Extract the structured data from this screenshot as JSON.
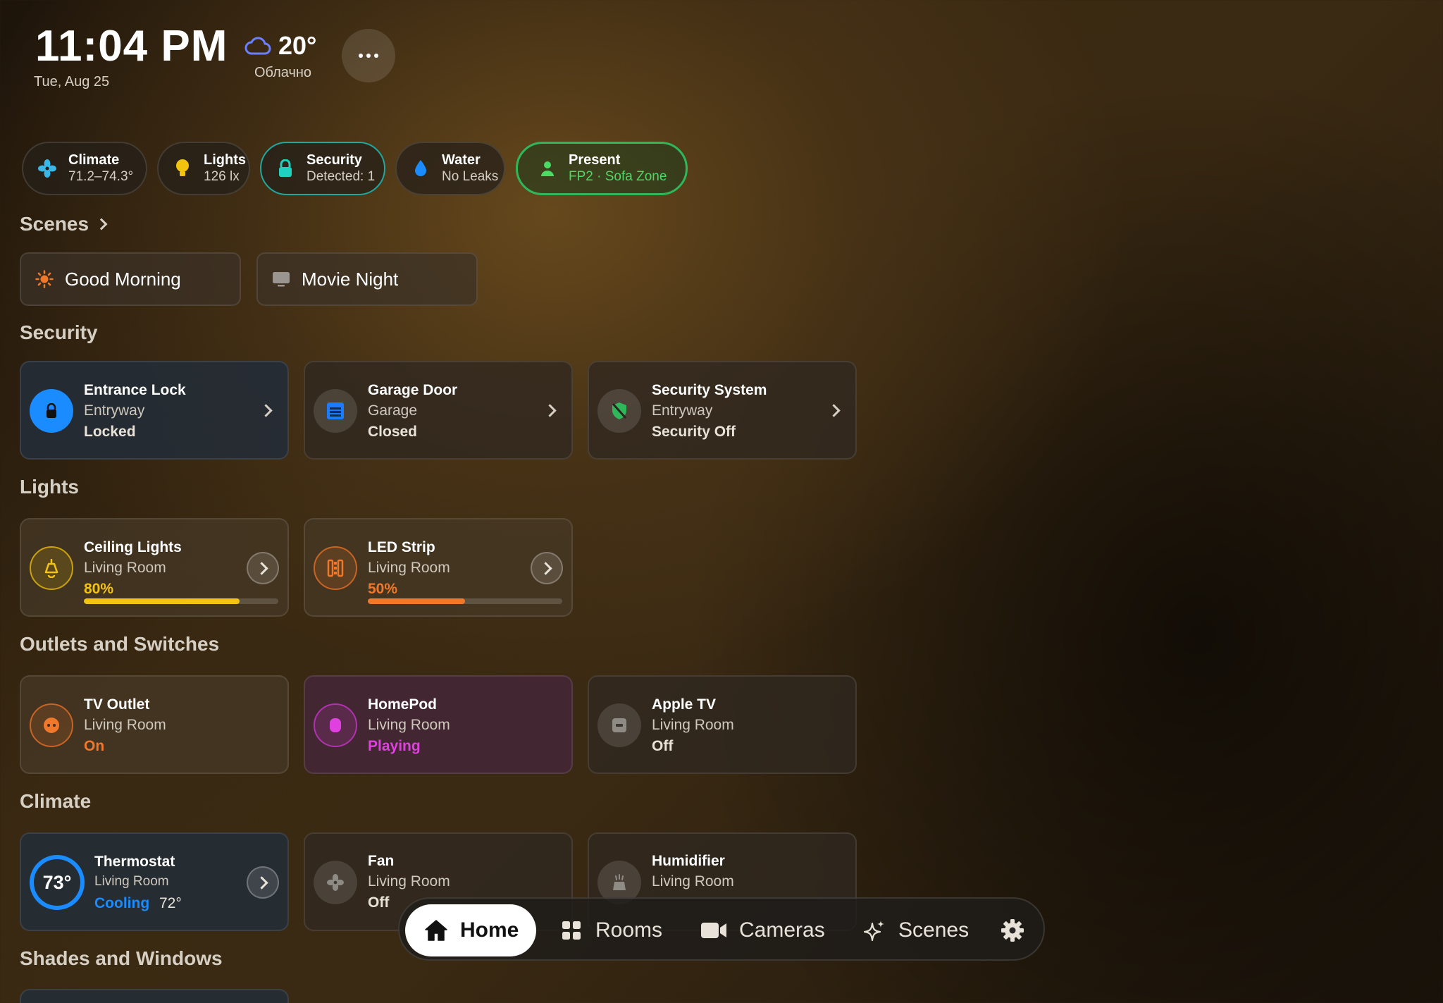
{
  "header": {
    "time": "11:04 PM",
    "date": "Tue, Aug 25",
    "temperature": "20°",
    "condition": "Облачно"
  },
  "status_chips": [
    {
      "title": "Climate",
      "subtitle": "71.2–74.3°",
      "icon": "fan-icon"
    },
    {
      "title": "Lights",
      "subtitle": "126 lx",
      "icon": "bulb-icon"
    },
    {
      "title": "Security",
      "subtitle": "Detected: 1",
      "icon": "lock-icon"
    },
    {
      "title": "Water",
      "subtitle": "No Leaks",
      "icon": "drop-icon"
    },
    {
      "title": "Present",
      "subtitle": "FP2 · Sofa Zone",
      "icon": "person-icon"
    }
  ],
  "sections": {
    "scenes": "Scenes",
    "security": "Security",
    "lights": "Lights",
    "outlets": "Outlets and Switches",
    "climate": "Climate",
    "shades": "Shades and Windows"
  },
  "scenes": [
    {
      "label": "Good Morning",
      "icon": "sun-icon"
    },
    {
      "label": "Movie Night",
      "icon": "tv-icon"
    }
  ],
  "security": [
    {
      "name": "Entrance Lock",
      "room": "Entryway",
      "state": "Locked"
    },
    {
      "name": "Garage Door",
      "room": "Garage",
      "state": "Closed"
    },
    {
      "name": "Security System",
      "room": "Entryway",
      "state": "Security Off"
    }
  ],
  "lights": [
    {
      "name": "Ceiling Lights",
      "room": "Living Room",
      "state": "80%",
      "level": 0.8
    },
    {
      "name": "LED Strip",
      "room": "Living Room",
      "state": "50%",
      "level": 0.5
    }
  ],
  "outlets": [
    {
      "name": "TV Outlet",
      "room": "Living Room",
      "state": "On"
    },
    {
      "name": "HomePod",
      "room": "Living Room",
      "state": "Playing"
    },
    {
      "name": "Apple TV",
      "room": "Living Room",
      "state": "Off"
    }
  ],
  "climate": [
    {
      "name": "Thermostat",
      "room": "Living Room",
      "state": "Cooling",
      "target": "72°",
      "current": "73°"
    },
    {
      "name": "Fan",
      "room": "Living Room",
      "state": "Off"
    },
    {
      "name": "Humidifier",
      "room": "Living Room"
    }
  ],
  "nav": [
    {
      "label": "Home"
    },
    {
      "label": "Rooms"
    },
    {
      "label": "Cameras"
    },
    {
      "label": "Scenes"
    }
  ],
  "colors": {
    "accent_blue": "#1a8cff",
    "light_yellow": "#f2c40f",
    "led_orange": "#f0782a",
    "playing_pink": "#e040e0",
    "present_green": "#4cd964",
    "teal": "#1fa8a0"
  }
}
